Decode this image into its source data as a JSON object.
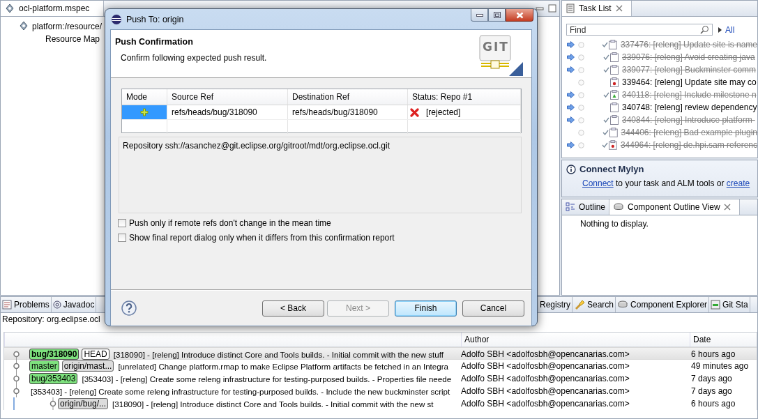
{
  "editor": {
    "tabs": [
      {
        "label": "ocl-platform.mspec",
        "selected": true,
        "kind": "spec"
      }
    ],
    "tree": [
      {
        "label": "platform:/resource/",
        "children": [
          {
            "label": "Resource Map"
          }
        ]
      }
    ]
  },
  "task_list": {
    "title": "Task List",
    "search": {
      "placeholder": "Find"
    },
    "filter_link": "All",
    "tasks": [
      {
        "text": "337476: [releng] Update site is name",
        "completed": true,
        "incoming": true,
        "kind": "task"
      },
      {
        "text": "339076: [releng] Avoid creating java",
        "completed": true,
        "incoming": true,
        "kind": "task"
      },
      {
        "text": "339077: [releng] Buckminster comm",
        "completed": true,
        "incoming": true,
        "kind": "task"
      },
      {
        "text": "339464: [releng] Update site may co",
        "completed": false,
        "incoming": false,
        "kind": "bug"
      },
      {
        "text": "340118: [releng] Include milestone n",
        "completed": true,
        "incoming": true,
        "kind": "enhancement"
      },
      {
        "text": "340748: [releng] review dependency",
        "completed": false,
        "incoming": true,
        "kind": "task"
      },
      {
        "text": "340844: [releng] Introduce platform-",
        "completed": true,
        "incoming": true,
        "kind": "task"
      },
      {
        "text": "344406: [releng] Bad example plugin",
        "completed": true,
        "incoming": false,
        "kind": "task"
      },
      {
        "text": "344964: [releng] de.hpi.sam referenc",
        "completed": true,
        "incoming": true,
        "kind": "bug"
      }
    ]
  },
  "mylyn": {
    "title": "Connect Mylyn",
    "message": [
      {
        "text": "Connect",
        "kind": "link"
      },
      {
        "text": "to your task and ALM tools or",
        "kind": "text"
      },
      {
        "text": "create",
        "kind": "link"
      }
    ]
  },
  "outline": {
    "tabs": [
      {
        "label": "Outline",
        "selected": false,
        "kind": "outline"
      },
      {
        "label": "Component Outline View",
        "selected": true,
        "kind": "component"
      }
    ],
    "message": "Nothing to display."
  },
  "bottom_tabs_left": [
    {
      "label": "Problems",
      "kind": "problems"
    },
    {
      "label": "Javadoc",
      "kind": "at"
    }
  ],
  "bottom_tabs_right": [
    {
      "label": "Registry",
      "kind": "none"
    },
    {
      "label": "Search",
      "kind": "search"
    },
    {
      "label": "Component Explorer",
      "kind": "component"
    },
    {
      "label": "Git Sta",
      "kind": "git"
    }
  ],
  "history": {
    "repository": "Repository: org.eclipse.ocl",
    "columns": [
      "Author",
      "Date"
    ],
    "rows": [
      {
        "refs": [
          {
            "label": "bug/318090",
            "kind": "local",
            "current": true
          },
          {
            "label": "HEAD",
            "kind": "head"
          }
        ],
        "message": "[318090] - [releng] Introduce distinct Core and Tools builds. - Initial commit with the new stuff",
        "author": "Adolfo SBH <adolfosbh@opencanarias.com>",
        "date": "6 hours ago",
        "selected": true,
        "kind": "main"
      },
      {
        "refs": [
          {
            "label": "master",
            "kind": "local",
            "current": false
          },
          {
            "label": "origin/mast...",
            "kind": "remote"
          }
        ],
        "message": "[unrelated] Change platform.rmap to make Eclipse Platform artifacts be fetched in an Integra",
        "author": "Adolfo SBH <adolfosbh@opencanarias.com>",
        "date": "49 minutes ago",
        "selected": false,
        "kind": "main"
      },
      {
        "refs": [
          {
            "label": "bug/353403",
            "kind": "local",
            "current": false
          }
        ],
        "message": "[353403] - [releng] Create some releng infrastructure for testing-purposed builds. - Properties file neede",
        "author": "Adolfo SBH <adolfosbh@opencanarias.com>",
        "date": "7 days ago",
        "selected": false,
        "kind": "main"
      },
      {
        "refs": [],
        "message": "[353403] - [releng] Create some releng infrastructure for testing-purposed builds. - Include the new buckminster script",
        "author": "Adolfo SBH <adolfosbh@opencanarias.com>",
        "date": "7 days ago",
        "selected": false,
        "kind": "main"
      },
      {
        "refs": [
          {
            "label": "origin/bug/...",
            "kind": "remote"
          }
        ],
        "message": "[318090] - [releng] Introduce distinct Core and Tools builds. - Initial commit with the new st",
        "author": "Adolfo SBH <adolfosbh@opencanarias.com>",
        "date": "6 hours ago",
        "selected": false,
        "kind": "side"
      }
    ]
  },
  "dialog": {
    "title": "Push To: origin",
    "heading": "Push Confirmation",
    "description": "Confirm following expected push result.",
    "logo_text": "GIT",
    "table": {
      "columns": [
        "Mode",
        "Source Ref",
        "Destination Ref",
        "Status: Repo #1"
      ],
      "rows": [
        {
          "mode": {
            "kind": "add"
          },
          "source": "refs/heads/bug/318090",
          "destination": "refs/heads/bug/318090",
          "status": {
            "text": "[rejected]",
            "kind": "error"
          },
          "selected": true
        }
      ]
    },
    "repository": "Repository ssh://asanchez@git.eclipse.org/gitroot/mdt/org.eclipse.ocl.git",
    "options": [
      {
        "label": "Push only if remote refs don't change in the mean time",
        "checked": false
      },
      {
        "label": "Show final report dialog only when it differs from this confirmation report",
        "checked": false
      }
    ],
    "buttons": [
      {
        "label": "< Back",
        "disabled": false,
        "default": false
      },
      {
        "label": "Next >",
        "disabled": true,
        "default": false
      },
      {
        "label": "Finish",
        "disabled": false,
        "default": true
      },
      {
        "label": "Cancel",
        "disabled": false,
        "default": false
      }
    ]
  }
}
